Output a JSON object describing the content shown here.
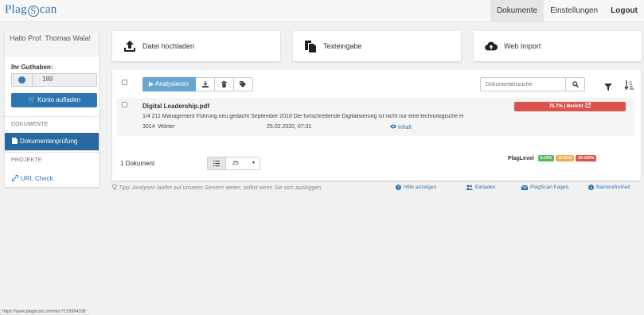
{
  "app": {
    "logo_left": "Plag",
    "logo_s": "S",
    "logo_right": "can"
  },
  "nav": {
    "documents": "Dokumente",
    "settings": "Einstellungen",
    "logout": "Logout"
  },
  "sidebar": {
    "greeting": "Hallo Prof. Thomas Wala!",
    "credit_label": "Ihr Guthaben:",
    "credit_value": "189",
    "topup_button": "Konto aufladen",
    "section_documents": "DOKUMENTE",
    "nav_document_check": "Dokumentenprüfung",
    "section_projects": "PROJEKTE",
    "nav_url_check": "URL Check"
  },
  "actions": {
    "upload": "Datei hochladen",
    "text_input": "Texteingabe",
    "web_import": "Web Import"
  },
  "toolbar": {
    "analyse": "Analysieren",
    "search_placeholder": "Dokumentensuche"
  },
  "document": {
    "title": "Digital Leadership.pdf",
    "excerpt": "1/4 211 Management Führung neu gedacht September 2018 Die fortschreitende Digitalisierung ist nicht nur eine technologische H",
    "words_count": "3014",
    "words_label": "Wörter",
    "date": "25.02.2020, 07:31",
    "content_link": "Inhalt",
    "score": "75.7% | Bericht"
  },
  "footer_panel": {
    "count": "1 Dokument",
    "page_size": "25",
    "plaglevel_label": "PlagLevel",
    "levels": [
      {
        "label": "0-10%",
        "color": "#5cb85c"
      },
      {
        "label": "10-20%",
        "color": "#f0ad4e"
      },
      {
        "label": "20-100%",
        "color": "#d9534f"
      }
    ]
  },
  "tips": {
    "tip": "Tipp: Analysen laufen auf unseren Servern weiter, selbst wenn Sie sich ausloggen.",
    "help": "Hilfe anzeigen",
    "invite": "Einladen",
    "ask": "PlagScan fragen",
    "accessibility": "Barrierefreiheit"
  },
  "statusbar": "https://www.plagscan.com/doc?129584108",
  "colors": {
    "primary": "#2d75b2",
    "active_nav": "#27689f",
    "score_red": "#d9534f"
  }
}
